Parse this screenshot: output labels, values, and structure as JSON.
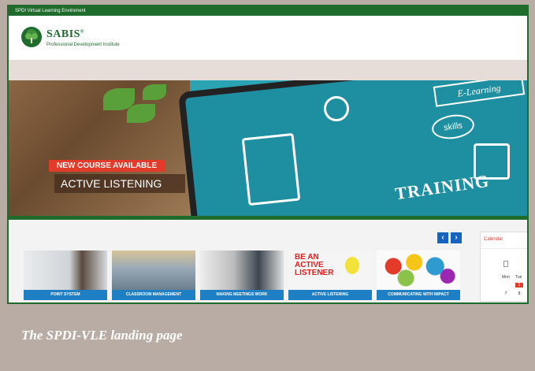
{
  "site": {
    "topbar_title": "SPDI Virtual Learning Enviroment",
    "brand_name": "SABIS",
    "brand_mark": "®",
    "brand_subtitle": "Professional Development Institute"
  },
  "hero": {
    "badge": "NEW COURSE AVAILABLE",
    "course_title": "ACTIVE LISTENING",
    "screen_words": {
      "training": "TRAINING",
      "skills": "skills",
      "elearning": "E-Learning"
    }
  },
  "carousel": {
    "prev_icon": "chevron-left-icon",
    "next_icon": "chevron-right-icon",
    "prev_glyph": "‹",
    "next_glyph": "›",
    "courses": [
      {
        "label": "POINT SYSTEM"
      },
      {
        "label": "CLASSROOM MANAGEMENT"
      },
      {
        "label": "MAKING MEETINGS WORK"
      },
      {
        "label": "ACTIVE LISTENING"
      },
      {
        "label": "COMMUNICATING WITH IMPACT"
      }
    ]
  },
  "calendar": {
    "title": "Calendar",
    "days": [
      "Mon",
      "Tue"
    ],
    "dates": [
      "7",
      "8"
    ],
    "highlighted_date": "1"
  },
  "caption": "The SPDI-VLE landing page",
  "colors": {
    "brand_green": "#1f6b2c",
    "accent_red": "#e23b2a",
    "tile_blue": "#1f7fc4",
    "nav_blue": "#1565c0"
  }
}
